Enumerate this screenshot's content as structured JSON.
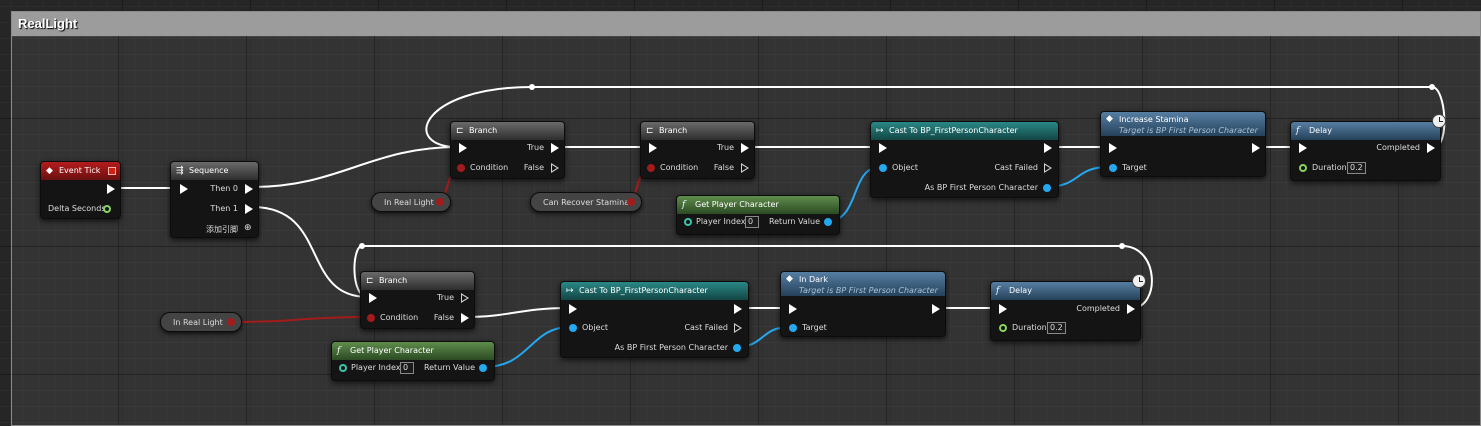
{
  "comment": {
    "title": "RealLight"
  },
  "colors": {
    "exec_wire": "#ffffff",
    "bool_wire": "#a41b1b",
    "object_wire": "#24a8f0"
  },
  "nodes": {
    "event_tick": {
      "title": "Event Tick",
      "delta_seconds": "Delta Seconds"
    },
    "sequence": {
      "title": "Sequence",
      "then0": "Then 0",
      "then1": "Then 1",
      "add_pin": "添加引脚"
    },
    "branch_top1": {
      "title": "Branch",
      "condition": "Condition",
      "true_label": "True",
      "false_label": "False"
    },
    "branch_top2": {
      "title": "Branch",
      "condition": "Condition",
      "true_label": "True",
      "false_label": "False"
    },
    "branch_bottom": {
      "title": "Branch",
      "condition": "Condition",
      "true_label": "True",
      "false_label": "False"
    },
    "var_in_real_light_top": {
      "label": "In Real Light"
    },
    "var_can_recover_stamina": {
      "label": "Can Recover Stamina"
    },
    "var_in_real_light_bottom": {
      "label": "In Real Light"
    },
    "get_player_top": {
      "title": "Get Player Character",
      "player_index": "Player Index",
      "index_value": "0",
      "return_value": "Return Value"
    },
    "get_player_bottom": {
      "title": "Get Player Character",
      "player_index": "Player Index",
      "index_value": "0",
      "return_value": "Return Value"
    },
    "cast_top": {
      "title": "Cast To BP_FirstPersonCharacter",
      "object": "Object",
      "cast_failed": "Cast Failed",
      "as_label": "As BP First Person Character"
    },
    "cast_bottom": {
      "title": "Cast To BP_FirstPersonCharacter",
      "object": "Object",
      "cast_failed": "Cast Failed",
      "as_label": "As BP First Person Character"
    },
    "increase_stamina": {
      "title": "Increase Stamina",
      "subtitle": "Target is BP First Person Character",
      "target": "Target"
    },
    "in_dark": {
      "title": "In Dark",
      "subtitle": "Target is BP First Person Character",
      "target": "Target"
    },
    "delay_top": {
      "title": "Delay",
      "completed": "Completed",
      "duration": "Duration",
      "duration_value": "0.2"
    },
    "delay_bottom": {
      "title": "Delay",
      "completed": "Completed",
      "duration": "Duration",
      "duration_value": "0.2"
    }
  }
}
